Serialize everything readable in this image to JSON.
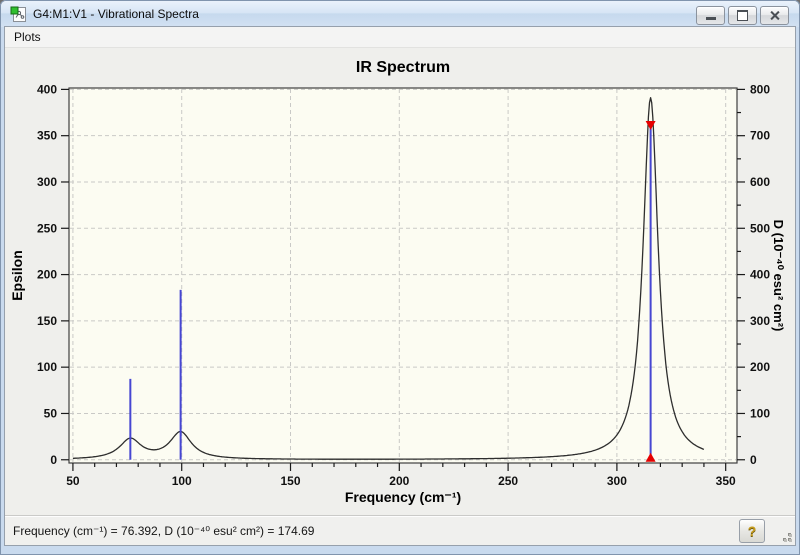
{
  "window": {
    "title": "G4:M1:V1 - Vibrational Spectra",
    "icons": {
      "app_icon": "molecule-document-icon",
      "minimize": "minimize-icon",
      "maximize": "maximize-icon",
      "close": "close-icon",
      "help": "question-mark-icon",
      "resize": "resize-grip-icon"
    }
  },
  "menu": {
    "items": [
      {
        "label": "Plots"
      }
    ]
  },
  "chart_data": {
    "type": "line",
    "title": "IR Spectrum",
    "xlabel": "Frequency (cm⁻¹)",
    "ylabel_left": "Epsilon",
    "ylabel_right": "D (10⁻⁴⁰ esu² cm²)",
    "x_ticks": [
      50,
      100,
      150,
      200,
      250,
      300,
      350
    ],
    "x_minor_step": 10,
    "x_axis_range": [
      48.2,
      355.2
    ],
    "y_left_ticks": [
      0,
      50,
      100,
      150,
      200,
      250,
      300,
      350,
      400
    ],
    "y_left_range": [
      0,
      400
    ],
    "y_right_ticks": [
      0,
      100,
      200,
      300,
      400,
      500,
      600,
      700,
      800
    ],
    "y_right_minor_step": 50,
    "y_right_range": [
      0,
      800
    ],
    "grid": "dashed",
    "legend": "none",
    "peaks": [
      {
        "frequency": 76.392,
        "d": 174.69,
        "epsilon_height": 21.5,
        "gamma": 6.0,
        "selected": false
      },
      {
        "frequency": 99.5,
        "d": 367.0,
        "epsilon_height": 29.0,
        "gamma": 6.0,
        "selected": false
      },
      {
        "frequency": 315.5,
        "d": 723.0,
        "epsilon_height": 391.0,
        "gamma": 4.2,
        "selected": true
      }
    ],
    "curve_x_range": [
      50,
      340
    ],
    "colors": {
      "curve": "#2e2e2e",
      "stick": "#4646d2",
      "selection_marker": "#e60000",
      "grid": "#c9c9c6",
      "plot_background": "#fcfcf2",
      "frame": "#3f3f3f"
    }
  },
  "status_bar": {
    "text": "Frequency (cm⁻¹) = 76.392, D (10⁻⁴⁰ esu² cm²) = 174.69",
    "help_label": "?"
  }
}
